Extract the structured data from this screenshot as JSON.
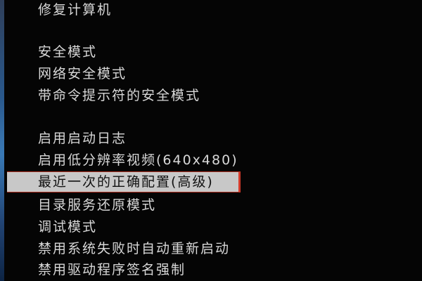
{
  "menu": {
    "repair": "修复计算机",
    "safe_mode": "安全模式",
    "safe_mode_networking": "网络安全模式",
    "safe_mode_cmd": "带命令提示符的安全模式",
    "boot_logging": "启用启动日志",
    "low_res_video": "启用低分辨率视频(640x480)",
    "last_known_good": "最近一次的正确配置(高级)",
    "ds_restore": "目录服务还原模式",
    "debug_mode": "调试模式",
    "disable_auto_restart": "禁用系统失败时自动重新启动",
    "disable_driver_signature": "禁用驱动程序签名强制"
  },
  "selected_item": "last_known_good",
  "colors": {
    "background": "#050505",
    "text": "#d8d8d8",
    "highlight_bg": "#c8c8c8",
    "highlight_text": "#111111",
    "highlight_border": "#d33a2a"
  }
}
